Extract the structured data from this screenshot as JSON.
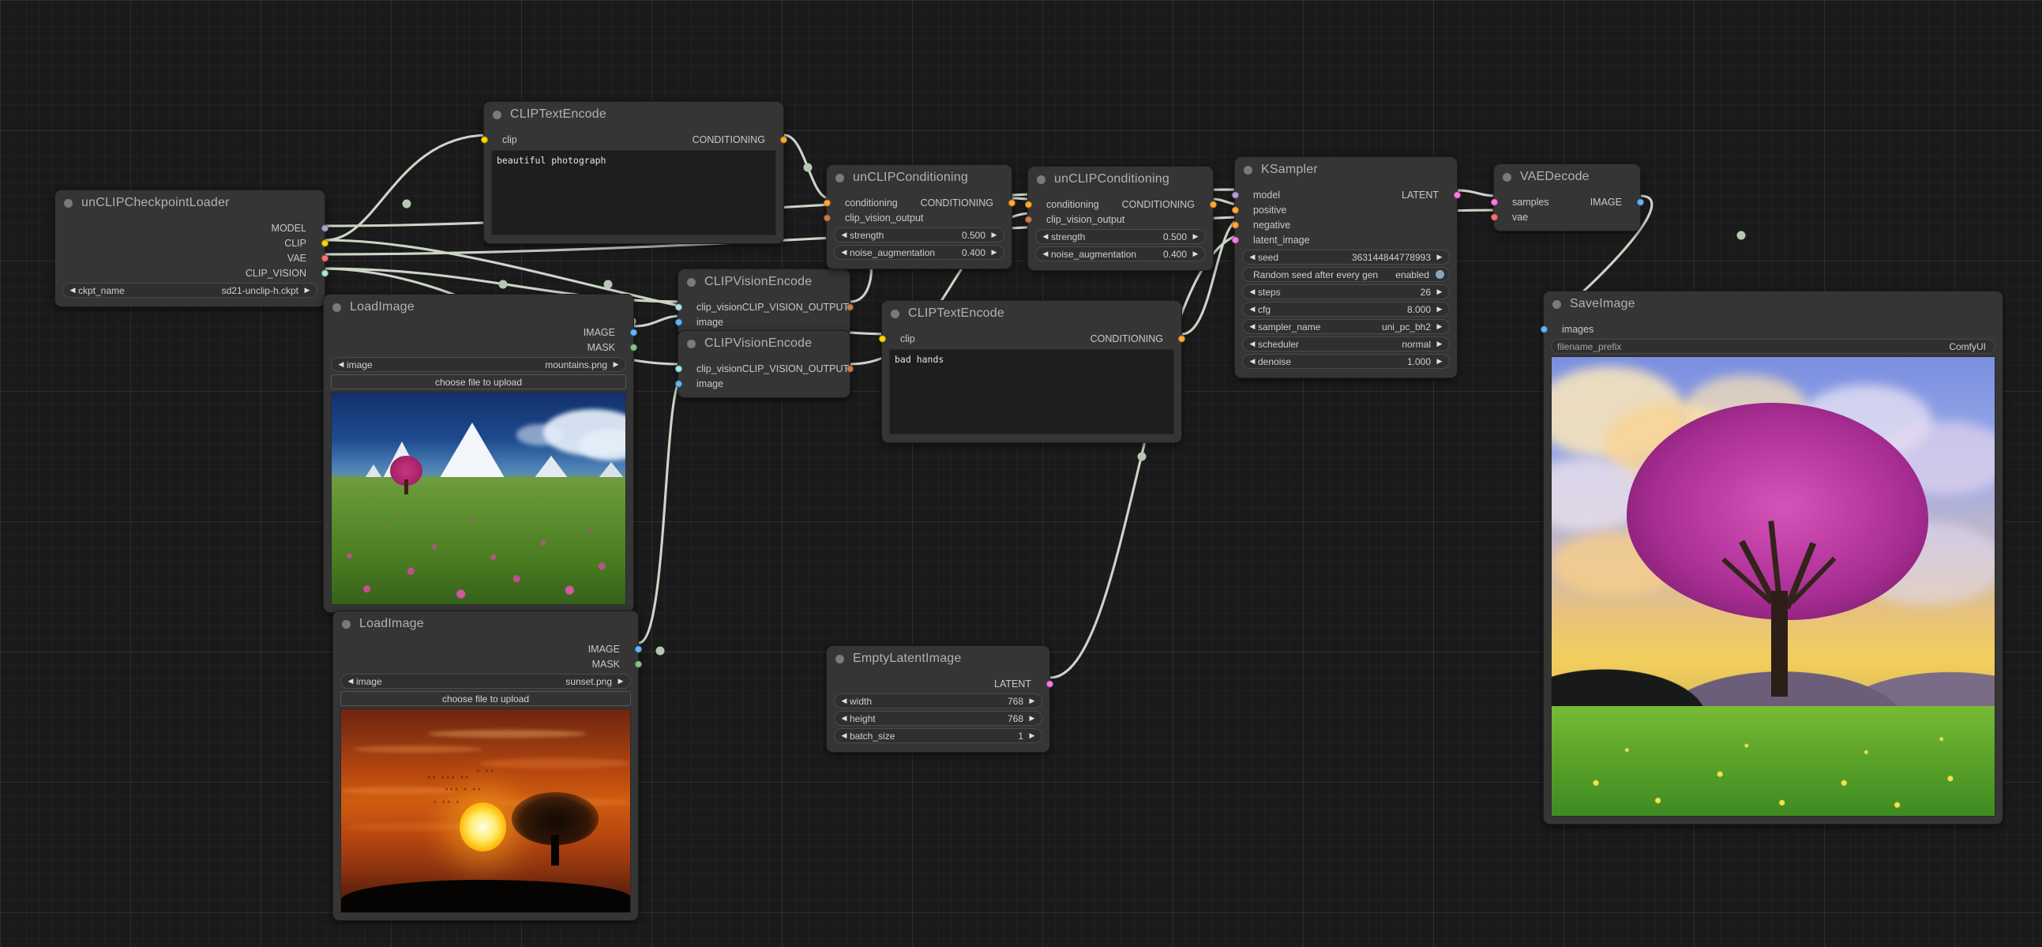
{
  "app": {
    "name": "ComfyUI",
    "canvas_background": "#1a1a1a"
  },
  "port_colors": {
    "MODEL": "#b39ddb",
    "CLIP": "#ffd500",
    "VAE": "#ff6e6e",
    "CLIP_VISION": "#a8e6e0",
    "CLIP_VISION_OUTPUT": "#c77b4e",
    "CONDITIONING": "#ffa931",
    "LATENT": "#ff79e1",
    "IMAGE": "#64b5f6",
    "MASK": "#81c784"
  },
  "nodes": [
    {
      "id": "unclip-checkpoint-loader",
      "title": "unCLIPCheckpointLoader",
      "outputs": [
        {
          "label": "MODEL",
          "type": "MODEL"
        },
        {
          "label": "CLIP",
          "type": "CLIP"
        },
        {
          "label": "VAE",
          "type": "VAE"
        },
        {
          "label": "CLIP_VISION",
          "type": "CLIP_VISION"
        }
      ],
      "widgets": [
        {
          "name": "ckpt_name",
          "value": "sd21-unclip-h.ckpt"
        }
      ]
    },
    {
      "id": "clip-text-encode-positive",
      "title": "CLIPTextEncode",
      "inputs": [
        {
          "label": "clip",
          "type": "CLIP"
        }
      ],
      "outputs": [
        {
          "label": "CONDITIONING",
          "type": "CONDITIONING"
        }
      ],
      "text": "beautiful photograph"
    },
    {
      "id": "clip-text-encode-negative",
      "title": "CLIPTextEncode",
      "inputs": [
        {
          "label": "clip",
          "type": "CLIP"
        }
      ],
      "outputs": [
        {
          "label": "CONDITIONING",
          "type": "CONDITIONING"
        }
      ],
      "text": "bad hands"
    },
    {
      "id": "load-image-mountains",
      "title": "LoadImage",
      "outputs": [
        {
          "label": "IMAGE",
          "type": "IMAGE"
        },
        {
          "label": "MASK",
          "type": "MASK"
        }
      ],
      "widgets": [
        {
          "name": "image",
          "value": "mountains.png"
        }
      ],
      "upload_button": "choose file to upload"
    },
    {
      "id": "load-image-sunset",
      "title": "LoadImage",
      "outputs": [
        {
          "label": "IMAGE",
          "type": "IMAGE"
        },
        {
          "label": "MASK",
          "type": "MASK"
        }
      ],
      "widgets": [
        {
          "name": "image",
          "value": "sunset.png"
        }
      ],
      "upload_button": "choose file to upload"
    },
    {
      "id": "clip-vision-encode-1",
      "title": "CLIPVisionEncode",
      "inputs": [
        {
          "label": "clip_vision",
          "type": "CLIP_VISION"
        },
        {
          "label": "image",
          "type": "IMAGE"
        }
      ],
      "outputs": [
        {
          "label": "CLIP_VISION_OUTPUT",
          "type": "CLIP_VISION_OUTPUT"
        }
      ]
    },
    {
      "id": "clip-vision-encode-2",
      "title": "CLIPVisionEncode",
      "inputs": [
        {
          "label": "clip_vision",
          "type": "CLIP_VISION"
        },
        {
          "label": "image",
          "type": "IMAGE"
        }
      ],
      "outputs": [
        {
          "label": "CLIP_VISION_OUTPUT",
          "type": "CLIP_VISION_OUTPUT"
        }
      ]
    },
    {
      "id": "unclip-conditioning-1",
      "title": "unCLIPConditioning",
      "inputs": [
        {
          "label": "conditioning",
          "type": "CONDITIONING"
        },
        {
          "label": "clip_vision_output",
          "type": "CLIP_VISION_OUTPUT"
        }
      ],
      "outputs": [
        {
          "label": "CONDITIONING",
          "type": "CONDITIONING"
        }
      ],
      "widgets": [
        {
          "name": "strength",
          "value": "0.500"
        },
        {
          "name": "noise_augmentation",
          "value": "0.400"
        }
      ]
    },
    {
      "id": "unclip-conditioning-2",
      "title": "unCLIPConditioning",
      "inputs": [
        {
          "label": "conditioning",
          "type": "CONDITIONING"
        },
        {
          "label": "clip_vision_output",
          "type": "CLIP_VISION_OUTPUT"
        }
      ],
      "outputs": [
        {
          "label": "CONDITIONING",
          "type": "CONDITIONING"
        }
      ],
      "widgets": [
        {
          "name": "strength",
          "value": "0.500"
        },
        {
          "name": "noise_augmentation",
          "value": "0.400"
        }
      ]
    },
    {
      "id": "ksampler",
      "title": "KSampler",
      "inputs": [
        {
          "label": "model",
          "type": "MODEL"
        },
        {
          "label": "positive",
          "type": "CONDITIONING"
        },
        {
          "label": "negative",
          "type": "CONDITIONING"
        },
        {
          "label": "latent_image",
          "type": "LATENT"
        }
      ],
      "outputs": [
        {
          "label": "LATENT",
          "type": "LATENT"
        }
      ],
      "widgets": [
        {
          "name": "seed",
          "value": "363144844778993"
        },
        {
          "name": "Random seed after every gen",
          "value": "enabled",
          "kind": "toggle"
        },
        {
          "name": "steps",
          "value": "26"
        },
        {
          "name": "cfg",
          "value": "8.000"
        },
        {
          "name": "sampler_name",
          "value": "uni_pc_bh2"
        },
        {
          "name": "scheduler",
          "value": "normal"
        },
        {
          "name": "denoise",
          "value": "1.000"
        }
      ]
    },
    {
      "id": "empty-latent-image",
      "title": "EmptyLatentImage",
      "outputs": [
        {
          "label": "LATENT",
          "type": "LATENT"
        }
      ],
      "widgets": [
        {
          "name": "width",
          "value": "768"
        },
        {
          "name": "height",
          "value": "768"
        },
        {
          "name": "batch_size",
          "value": "1"
        }
      ]
    },
    {
      "id": "vae-decode",
      "title": "VAEDecode",
      "inputs": [
        {
          "label": "samples",
          "type": "LATENT"
        },
        {
          "label": "vae",
          "type": "VAE"
        }
      ],
      "outputs": [
        {
          "label": "IMAGE",
          "type": "IMAGE"
        }
      ]
    },
    {
      "id": "save-image",
      "title": "SaveImage",
      "inputs": [
        {
          "label": "images",
          "type": "IMAGE"
        }
      ],
      "widgets": [
        {
          "name": "filename_prefix",
          "value": "ComfyUI"
        }
      ]
    }
  ],
  "arrows": {
    "left": "◀",
    "right": "▶"
  }
}
